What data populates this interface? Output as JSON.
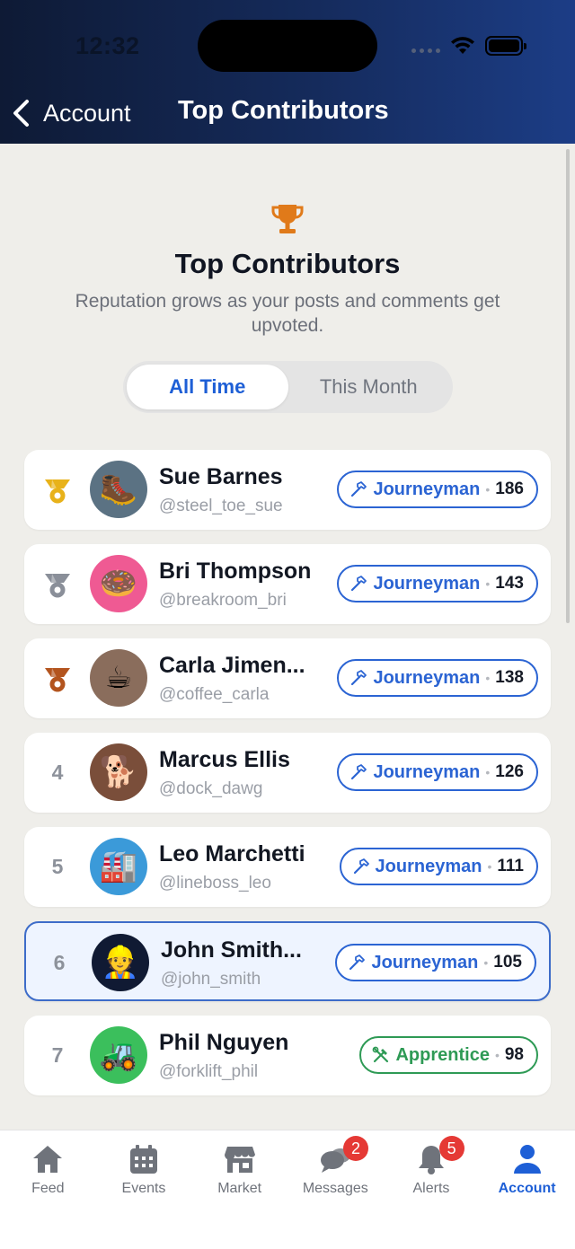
{
  "status": {
    "time": "12:32"
  },
  "header": {
    "back_label": "Account",
    "title": "Top Contributors"
  },
  "hero": {
    "title": "Top Contributors",
    "subtitle": "Reputation grows as your posts and comments get upvoted."
  },
  "segments": [
    "All Time",
    "This Month"
  ],
  "colors": {
    "accent": "#1e5fd6",
    "journeyman": "#2b64d3",
    "apprentice": "#2e9a55",
    "gold": "#e8b21a",
    "silver": "#8a8f99",
    "bronze": "#b3541e",
    "badge_red": "#e53935"
  },
  "contributors": [
    {
      "rank": "",
      "medal": "gold",
      "name": "Sue Barnes",
      "handle": "@steel_toe_sue",
      "level": "Journeyman",
      "score": "186",
      "avatar_emoji": "🥾",
      "avatar_bg": "#5b7283"
    },
    {
      "rank": "",
      "medal": "silver",
      "name": "Bri Thompson",
      "handle": "@breakroom_bri",
      "level": "Journeyman",
      "score": "143",
      "avatar_emoji": "🍩",
      "avatar_bg": "#ef5a93"
    },
    {
      "rank": "",
      "medal": "bronze",
      "name": "Carla Jimen...",
      "handle": "@coffee_carla",
      "level": "Journeyman",
      "score": "138",
      "avatar_emoji": "☕",
      "avatar_bg": "#8a6d5c"
    },
    {
      "rank": "4",
      "name": "Marcus Ellis",
      "handle": "@dock_dawg",
      "level": "Journeyman",
      "score": "126",
      "avatar_emoji": "🐕",
      "avatar_bg": "#7a4e3a"
    },
    {
      "rank": "5",
      "name": "Leo Marchetti",
      "handle": "@lineboss_leo",
      "level": "Journeyman",
      "score": "111",
      "avatar_emoji": "🏭",
      "avatar_bg": "#3b9ad9"
    },
    {
      "rank": "6",
      "name": "John Smith...",
      "handle": "@john_smith",
      "level": "Journeyman",
      "score": "105",
      "avatar_emoji": "👷",
      "avatar_bg": "#101a33",
      "is_me": true
    },
    {
      "rank": "7",
      "name": "Phil Nguyen",
      "handle": "@forklift_phil",
      "level": "Apprentice",
      "score": "98",
      "avatar_emoji": "🚜",
      "avatar_bg": "#3bbf5c"
    }
  ],
  "tabs": [
    {
      "label": "Feed",
      "icon": "home-icon"
    },
    {
      "label": "Events",
      "icon": "calendar-icon"
    },
    {
      "label": "Market",
      "icon": "storefront-icon"
    },
    {
      "label": "Messages",
      "icon": "chat-bubbles-icon",
      "badge": "2"
    },
    {
      "label": "Alerts",
      "icon": "bell-icon",
      "badge": "5"
    },
    {
      "label": "Account",
      "icon": "person-icon",
      "active": true
    }
  ]
}
